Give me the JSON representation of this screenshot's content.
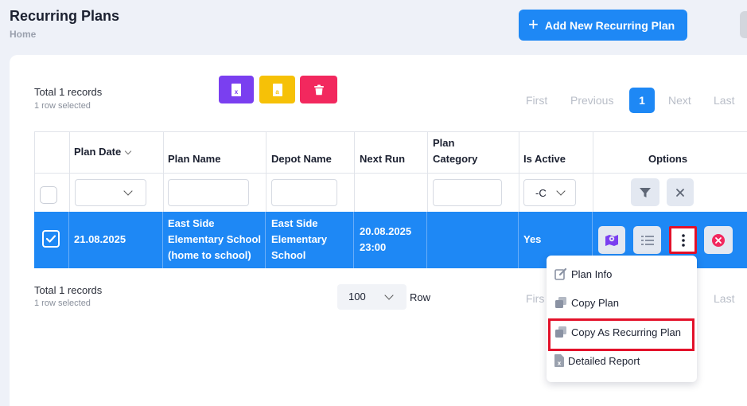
{
  "header": {
    "title": "Recurring Plans",
    "breadcrumb": "Home",
    "add_button_label": "Add New Recurring Plan"
  },
  "summary_top": {
    "records": "Total 1 records",
    "selected": "1 row selected"
  },
  "summary_bottom": {
    "records": "Total 1 records",
    "selected": "1 row selected"
  },
  "export": {
    "excel_icon": "excel-file-icon",
    "pdf_icon": "pdf-file-icon",
    "delete_icon": "trash-icon"
  },
  "pagination": {
    "first": "First",
    "previous": "Previous",
    "current_page": "1",
    "next": "Next",
    "last": "Last"
  },
  "pagination_bottom": {
    "first": "Firs",
    "last": "Last"
  },
  "table": {
    "columns": [
      "Plan Date",
      "Plan Name",
      "Depot Name",
      "Next Run",
      "Plan Category",
      "Is Active",
      "Options"
    ],
    "is_active_filter_value": "-C",
    "rows": [
      {
        "plan_date": "21.08.2025",
        "plan_name": "East Side Elementary School (home to school)",
        "depot_name": "East Side Elementary School",
        "next_run": "20.08.2025 23:00",
        "plan_category": "",
        "is_active": "Yes",
        "selected": true
      }
    ]
  },
  "page_size": {
    "value": "100",
    "label": "Row"
  },
  "options_menu": {
    "items": [
      {
        "label": "Plan Info",
        "icon": "edit-icon"
      },
      {
        "label": "Copy Plan",
        "icon": "copy-icon"
      },
      {
        "label": "Copy As Recurring Plan",
        "icon": "copy-icon",
        "highlighted": true
      },
      {
        "label": "Detailed Report",
        "icon": "excel-file-icon"
      }
    ]
  },
  "colors": {
    "primary": "#1e88f5",
    "excel_button": "#7a3ff0",
    "pdf_button": "#f6c107",
    "delete_button": "#f2285e",
    "highlight_border": "#e3112a",
    "map_icon": "#7a3ff0",
    "cancel_icon": "#f2285e"
  }
}
